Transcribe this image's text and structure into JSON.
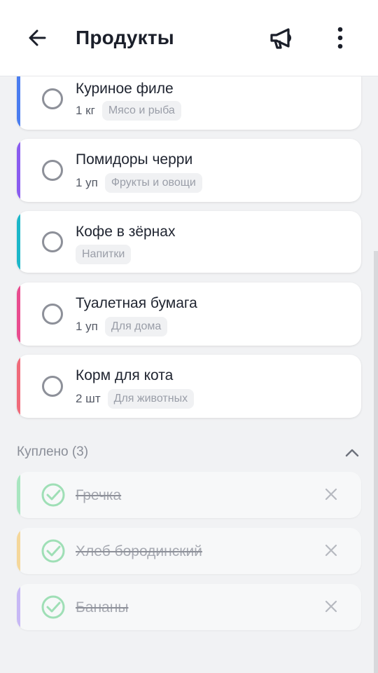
{
  "header": {
    "title": "Продукты"
  },
  "items": [
    {
      "name": "Куриное филе",
      "qty": "1 кг",
      "category": "Мясо и рыба",
      "color": "#4a7df0"
    },
    {
      "name": "Помидоры черри",
      "qty": "1 уп",
      "category": "Фрукты и овощи",
      "color": "#8a5cf0"
    },
    {
      "name": "Кофе в зёрнах",
      "qty": "",
      "category": "Напитки",
      "color": "#1cb7c9"
    },
    {
      "name": "Туалетная бумага",
      "qty": "1 уп",
      "category": "Для дома",
      "color": "#e94c8f"
    },
    {
      "name": "Корм для кота",
      "qty": "2 шт",
      "category": "Для животных",
      "color": "#f06b7a"
    }
  ],
  "purchased": {
    "label": "Куплено (3)",
    "items": [
      {
        "name": "Гречка",
        "color": "#a8e6c0"
      },
      {
        "name": "Хлеб бородинский",
        "color": "#f5d79a"
      },
      {
        "name": "Бананы",
        "color": "#c7b8f5"
      }
    ]
  },
  "icons": {
    "back": "arrow-left-icon",
    "share": "megaphone-icon",
    "menu": "more-vertical-icon",
    "collapse": "chevron-up-icon",
    "done": "check-circle-icon",
    "remove": "close-icon"
  }
}
